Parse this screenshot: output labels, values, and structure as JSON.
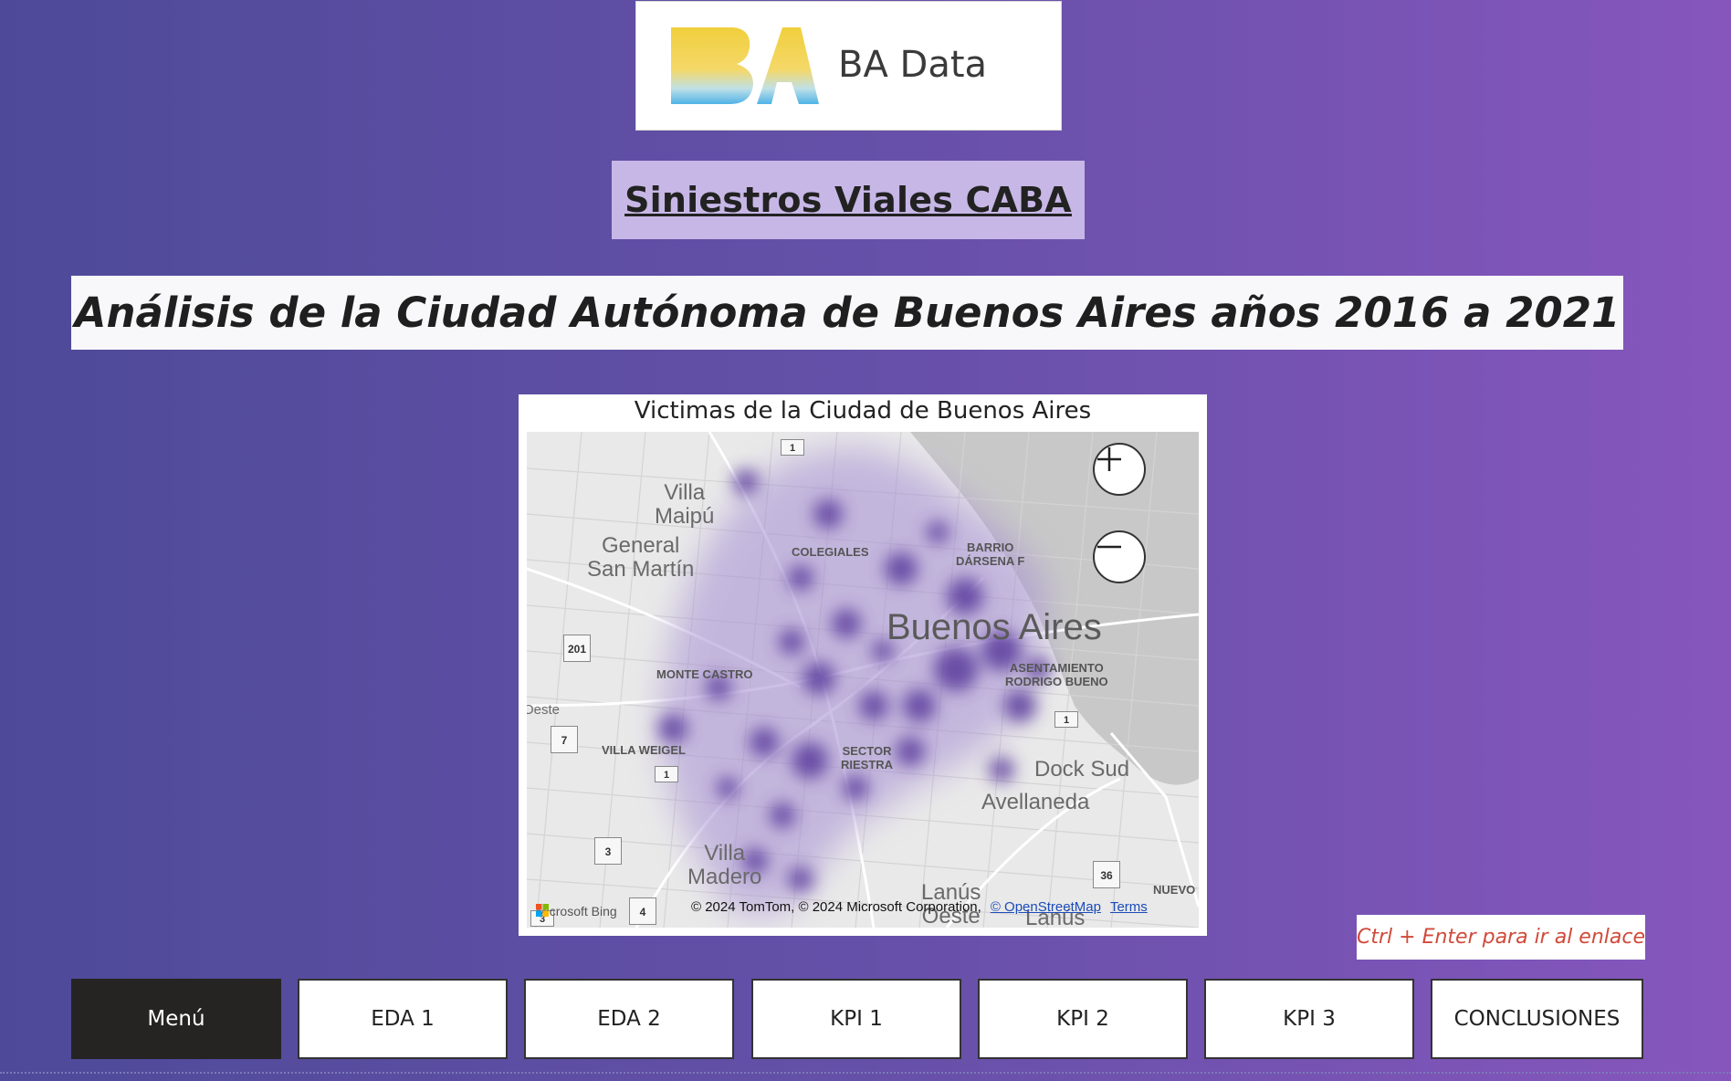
{
  "logo": {
    "text": "BA Data"
  },
  "subtitle": "Siniestros Viales CABA",
  "title": "Análisis de la Ciudad Autónoma de Buenos Aires años 2016 a 2021",
  "map": {
    "title": "Victimas de la Ciudad de Buenos Aires",
    "labels": {
      "villa_maipu": "Villa\nMaipú",
      "general_san_martin": "General\nSan Martín",
      "colegiales": "COLEGIALES",
      "barrio_darsena": "BARRIO\nDÁRSENA F",
      "buenos_aires": "Buenos Aires",
      "monte_castro": "MONTE CASTRO",
      "asentamiento": "ASENTAMIENTO\nRODRIGO BUENO",
      "oeste": "Oeste",
      "villa_weigel": "VILLA WEIGEL",
      "sector_riestra": "SECTOR\nRIESTRA",
      "dock_sud": "Dock Sud",
      "avellaneda": "Avellaneda",
      "villa_madero": "Villa\nMadero",
      "lanus_oeste": "Lanús\nOeste",
      "lanus": "Lanús",
      "nuevo": "NUEVO"
    },
    "shields": [
      "1",
      "201",
      "7",
      "1",
      "1",
      "3",
      "4",
      "3",
      "36"
    ],
    "attribution": "© 2024 TomTom, © 2024 Microsoft Corporation,",
    "osm_link": "© OpenStreetMap",
    "terms_link": "Terms",
    "bing": "Microsoft Bing"
  },
  "tooltip": "Ctrl + Enter para ir al enlace",
  "nav": {
    "menu": "Menú",
    "eda1": "EDA 1",
    "eda2": "EDA 2",
    "kpi1": "KPI 1",
    "kpi2": "KPI 2",
    "kpi3": "KPI 3",
    "conclusiones": "CONCLUSIONES"
  },
  "colors": {
    "heat": "#5a3a9c",
    "active_nav": "#252423",
    "tooltip_text": "#d04a3a",
    "subtitle_bg": "#c7b7e6"
  }
}
